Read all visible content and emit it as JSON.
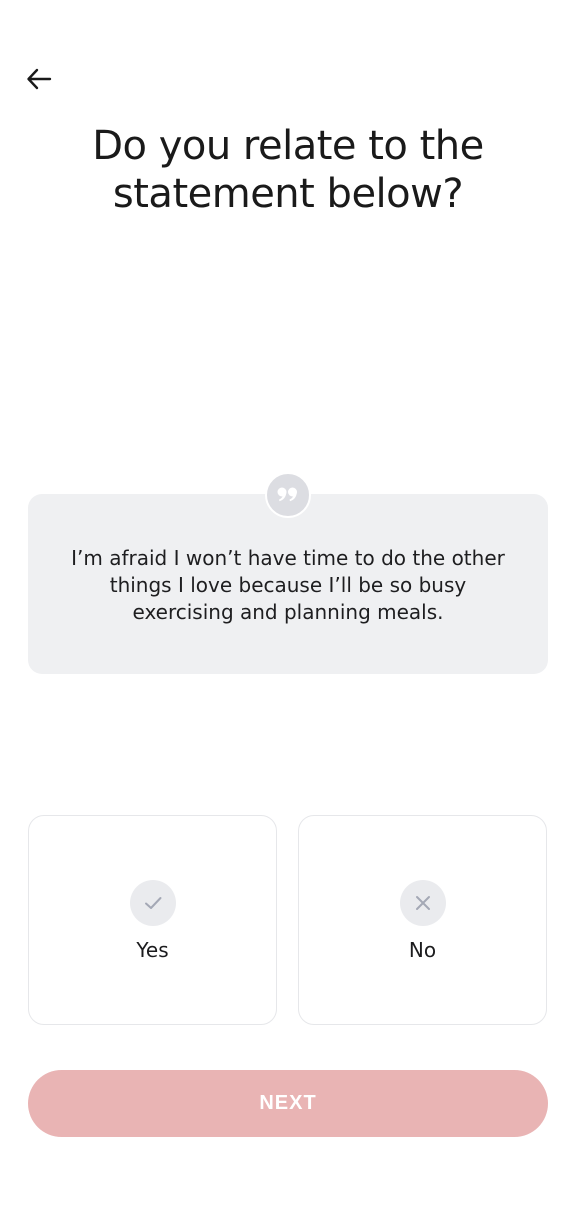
{
  "header": {
    "back_icon": "arrow-left-icon",
    "title": "Do you relate to the statement below?"
  },
  "statement": {
    "icon": "quote-icon",
    "text": "I’m afraid I won’t have time to do the other things I love because I’ll be so busy exercising and planning meals."
  },
  "options": [
    {
      "label": "Yes",
      "icon": "check-icon"
    },
    {
      "label": "No",
      "icon": "close-icon"
    }
  ],
  "footer": {
    "next_label": "NEXT"
  },
  "colors": {
    "accent_disabled": "#e9b4b4",
    "card_bg": "#eff0f2",
    "icon_bg": "#eaebee"
  }
}
